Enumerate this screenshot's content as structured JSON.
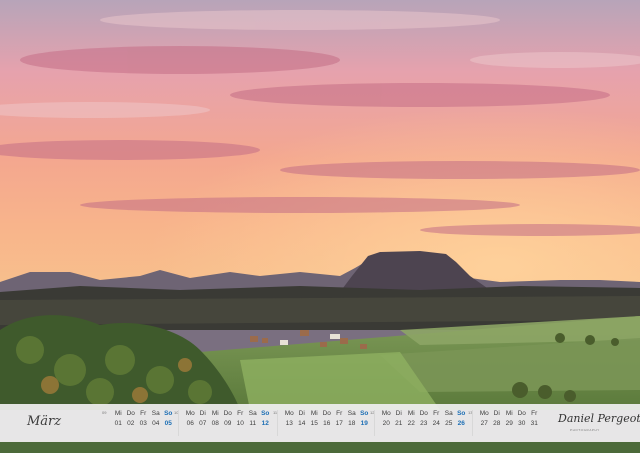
{
  "month": "März",
  "weeks": [
    {
      "kw": "09",
      "days": [
        {
          "n": "Mi",
          "d": "01"
        },
        {
          "n": "Do",
          "d": "02"
        },
        {
          "n": "Fr",
          "d": "03"
        },
        {
          "n": "Sa",
          "d": "04"
        },
        {
          "n": "So",
          "d": "05",
          "sun": true
        }
      ]
    },
    {
      "kw": "10",
      "days": [
        {
          "n": "Mo",
          "d": "06"
        },
        {
          "n": "Di",
          "d": "07"
        },
        {
          "n": "Mi",
          "d": "08"
        },
        {
          "n": "Do",
          "d": "09"
        },
        {
          "n": "Fr",
          "d": "10"
        },
        {
          "n": "Sa",
          "d": "11"
        },
        {
          "n": "So",
          "d": "12",
          "sun": true
        }
      ]
    },
    {
      "kw": "11",
      "days": [
        {
          "n": "Mo",
          "d": "13"
        },
        {
          "n": "Di",
          "d": "14"
        },
        {
          "n": "Mi",
          "d": "15"
        },
        {
          "n": "Do",
          "d": "16"
        },
        {
          "n": "Fr",
          "d": "17"
        },
        {
          "n": "Sa",
          "d": "18"
        },
        {
          "n": "So",
          "d": "19",
          "sun": true
        }
      ]
    },
    {
      "kw": "12",
      "days": [
        {
          "n": "Mo",
          "d": "20"
        },
        {
          "n": "Di",
          "d": "21"
        },
        {
          "n": "Mi",
          "d": "22"
        },
        {
          "n": "Do",
          "d": "23"
        },
        {
          "n": "Fr",
          "d": "24"
        },
        {
          "n": "Sa",
          "d": "25"
        },
        {
          "n": "So",
          "d": "26",
          "sun": true
        }
      ]
    },
    {
      "kw": "13",
      "days": [
        {
          "n": "Mo",
          "d": "27"
        },
        {
          "n": "Di",
          "d": "28"
        },
        {
          "n": "Mi",
          "d": "29"
        },
        {
          "n": "Do",
          "d": "30"
        },
        {
          "n": "Fr",
          "d": "31"
        }
      ]
    }
  ],
  "logo": {
    "name": "Daniel Pergeoticus",
    "sub": "PHOTOGRAPHY"
  },
  "colors": {
    "sunday": "#1d6fb5",
    "sky_top": "#c79fb8",
    "sky_glow": "#f59c6c"
  }
}
